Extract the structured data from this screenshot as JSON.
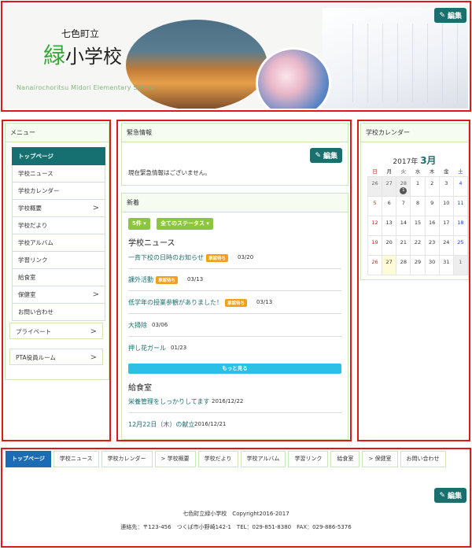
{
  "edit_label": "編集",
  "header": {
    "town": "七色町立",
    "school_green": "緑",
    "school_rest": "小学校",
    "school_en": "Nanairochoritsu Midori Elementary School"
  },
  "menu": {
    "title": "メニュー",
    "items": [
      {
        "label": "トップページ",
        "chev": ""
      },
      {
        "label": "学校ニュース",
        "chev": ""
      },
      {
        "label": "学校カレンダー",
        "chev": ""
      },
      {
        "label": "学校概要",
        "chev": ">"
      },
      {
        "label": "学校だより",
        "chev": ""
      },
      {
        "label": "学校アルバム",
        "chev": ""
      },
      {
        "label": "学習リンク",
        "chev": ""
      },
      {
        "label": "給食室",
        "chev": ""
      },
      {
        "label": "保健室",
        "chev": ">"
      },
      {
        "label": "お問い合わせ",
        "chev": ""
      }
    ],
    "private": "プライベート",
    "pta": "PTA役員ルーム",
    "chev": ">"
  },
  "emergency": {
    "title": "緊急情報",
    "text": "現在緊急情報はございません。"
  },
  "news": {
    "title": "新着",
    "count_btn": "5件 ▾",
    "status_btn": "全てのステータス ▾",
    "school_news_title": "学校ニュース",
    "items": [
      {
        "title": "一斉下校の日時のお知らせ",
        "badge": "承認待ち",
        "date": "03/20"
      },
      {
        "title": "課外活動",
        "badge": "承認待ち",
        "date": "03/13"
      },
      {
        "title": "低学年の授業参観がありました！",
        "badge": "承認待ち",
        "date": "03/13"
      },
      {
        "title": "大掃除",
        "badge": "",
        "date": "03/06"
      },
      {
        "title": "押し花ガール",
        "badge": "",
        "date": "01/23"
      }
    ],
    "more": "もっと見る",
    "lunch_title": "給食室",
    "lunch_items": [
      {
        "title": "栄養管理をしっかりしてます",
        "date": "2016/12/22"
      },
      {
        "title": "12月22日（木）の献立",
        "date": "2016/12/21"
      }
    ]
  },
  "calendar": {
    "title": "学校カレンダー",
    "year": "2017年",
    "month": "3月",
    "weekdays": [
      "日",
      "月",
      "火",
      "水",
      "木",
      "金",
      "土"
    ],
    "weeks": [
      [
        "26",
        "27",
        "28",
        "1",
        "2",
        "3",
        "4"
      ],
      [
        "5",
        "6",
        "7",
        "8",
        "9",
        "10",
        "11"
      ],
      [
        "12",
        "13",
        "14",
        "15",
        "16",
        "17",
        "18"
      ],
      [
        "19",
        "20",
        "21",
        "22",
        "23",
        "24",
        "25"
      ],
      [
        "26",
        "27",
        "28",
        "29",
        "30",
        "31",
        "1"
      ]
    ],
    "event_count": "1",
    "colors": {
      "sun": "#d01d1d",
      "sat": "#1d3fd0",
      "accent": "#1b6f6e"
    }
  },
  "footer": {
    "tabs": [
      "トップページ",
      "学校ニュース",
      "学校カレンダー",
      "> 学校概要",
      "学校だより",
      "学校アルバム",
      "学習リンク",
      "給食室",
      "> 保健室",
      "お問い合わせ"
    ],
    "copyright": "七色町立緑小学校　Copyright2016-2017",
    "contact": "連絡先：〒123-456　つくば市小野崎142-1　TEL：029-851-8380　FAX：029-886-5376"
  }
}
